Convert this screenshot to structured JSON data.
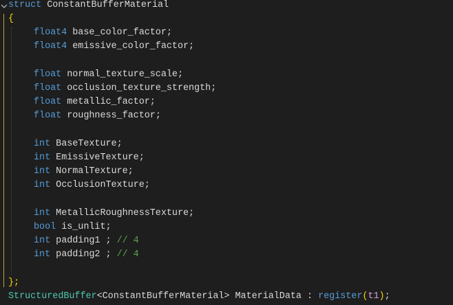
{
  "code": {
    "struct_keyword": "struct",
    "struct_name": "ConstantBufferMaterial",
    "open_brace": "{",
    "close_brace": "};",
    "lines": [
      {
        "type": "float4",
        "name": "base_color_factor",
        "end": ";"
      },
      {
        "type": "float4",
        "name": "emissive_color_factor",
        "end": ";"
      },
      {
        "type": "float",
        "name": "normal_texture_scale",
        "end": ";"
      },
      {
        "type": "float",
        "name": "occlusion_texture_strength",
        "end": ";"
      },
      {
        "type": "float",
        "name": "metallic_factor",
        "end": ";"
      },
      {
        "type": "float",
        "name": "roughness_factor",
        "end": ";"
      },
      {
        "type": "int",
        "name": "BaseTexture",
        "end": ";"
      },
      {
        "type": "int",
        "name": "EmissiveTexture",
        "end": ";"
      },
      {
        "type": "int",
        "name": "NormalTexture",
        "end": ";"
      },
      {
        "type": "int",
        "name": "OcclusionTexture",
        "end": ";"
      },
      {
        "type": "int",
        "name": "MetallicRoughnessTexture",
        "end": ";"
      },
      {
        "type": "bool",
        "name": "is_unlit",
        "end": ";"
      },
      {
        "type": "int",
        "name": "padding1",
        "end": " ;",
        "comment": "// 4"
      },
      {
        "type": "int",
        "name": "padding2",
        "end": " ;",
        "comment": "// 4"
      }
    ],
    "buffer_decl": {
      "template": "StructuredBuffer",
      "lt": "<",
      "arg": "ConstantBufferMaterial",
      "gt": ">",
      "var": "MaterialData",
      "colon": ":",
      "register_fn": "register",
      "lparen": "(",
      "register_arg": "t1",
      "rparen": ")",
      "semi": ";"
    }
  },
  "icons": {
    "fold": "chevron-down-icon"
  },
  "colors": {
    "background": "#1e1e1e",
    "keyword": "#569cd6",
    "identifier": "#dadada",
    "type_name": "#4ec9b0",
    "function": "#dcdcaa",
    "comment": "#57a64a",
    "fold_bar": "#bfa63a"
  }
}
